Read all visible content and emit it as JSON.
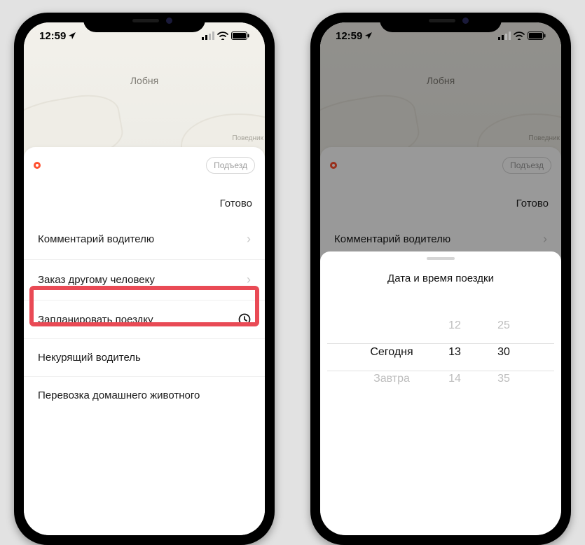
{
  "statusbar": {
    "time": "12:59"
  },
  "map": {
    "city": "Лобня",
    "edge_label": "Поведник"
  },
  "entrance_btn": "Подъезд",
  "sheet": {
    "done": "Готово",
    "options": {
      "comment": "Комментарий водителю",
      "order_other": "Заказ другому человеку",
      "schedule": "Запланировать поездку",
      "nonsmoker": "Некурящий водитель",
      "pet": "Перевозка домашнего животного"
    }
  },
  "picker": {
    "title": "Дата и время поездки",
    "rows": [
      {
        "day": "",
        "hour": "",
        "minute": ""
      },
      {
        "day": "",
        "hour": "12",
        "minute": "25"
      },
      {
        "day": "Сегодня",
        "hour": "13",
        "minute": "30"
      },
      {
        "day": "Завтра",
        "hour": "14",
        "minute": "35"
      }
    ]
  }
}
